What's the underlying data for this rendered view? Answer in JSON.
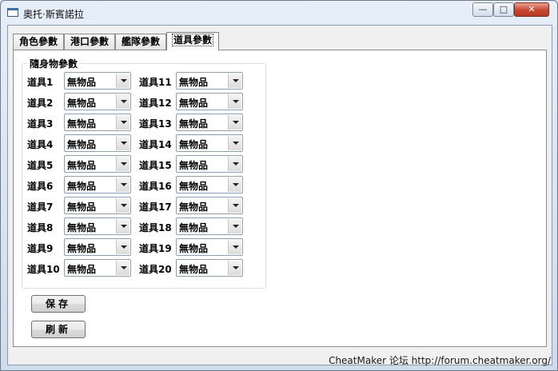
{
  "window": {
    "title": "奧托·斯賓諾拉",
    "minimize_glyph": "—",
    "maximize_glyph": "□",
    "close_glyph": "✕"
  },
  "tabs": [
    {
      "label": "角色參數",
      "active": false
    },
    {
      "label": "港口參數",
      "active": false
    },
    {
      "label": "艦隊參數",
      "active": false
    },
    {
      "label": "道具參數",
      "active": true
    }
  ],
  "group": {
    "label": "隨身物參數"
  },
  "items_left": [
    {
      "label": "道具1",
      "value": "無物品"
    },
    {
      "label": "道具2",
      "value": "無物品"
    },
    {
      "label": "道具3",
      "value": "無物品"
    },
    {
      "label": "道具4",
      "value": "無物品"
    },
    {
      "label": "道具5",
      "value": "無物品"
    },
    {
      "label": "道具6",
      "value": "無物品"
    },
    {
      "label": "道具7",
      "value": "無物品"
    },
    {
      "label": "道具8",
      "value": "無物品"
    },
    {
      "label": "道具9",
      "value": "無物品"
    },
    {
      "label": "道具10",
      "value": "無物品"
    }
  ],
  "items_right": [
    {
      "label": "道具11",
      "value": "無物品"
    },
    {
      "label": "道具12",
      "value": "無物品"
    },
    {
      "label": "道具13",
      "value": "無物品"
    },
    {
      "label": "道具14",
      "value": "無物品"
    },
    {
      "label": "道具15",
      "value": "無物品"
    },
    {
      "label": "道具16",
      "value": "無物品"
    },
    {
      "label": "道具17",
      "value": "無物品"
    },
    {
      "label": "道具18",
      "value": "無物品"
    },
    {
      "label": "道具19",
      "value": "無物品"
    },
    {
      "label": "道具20",
      "value": "無物品"
    }
  ],
  "buttons": {
    "save": "保存",
    "refresh": "刷新"
  },
  "footer": {
    "text": "CheatMaker 论坛 http://forum.cheatmaker.org/"
  }
}
